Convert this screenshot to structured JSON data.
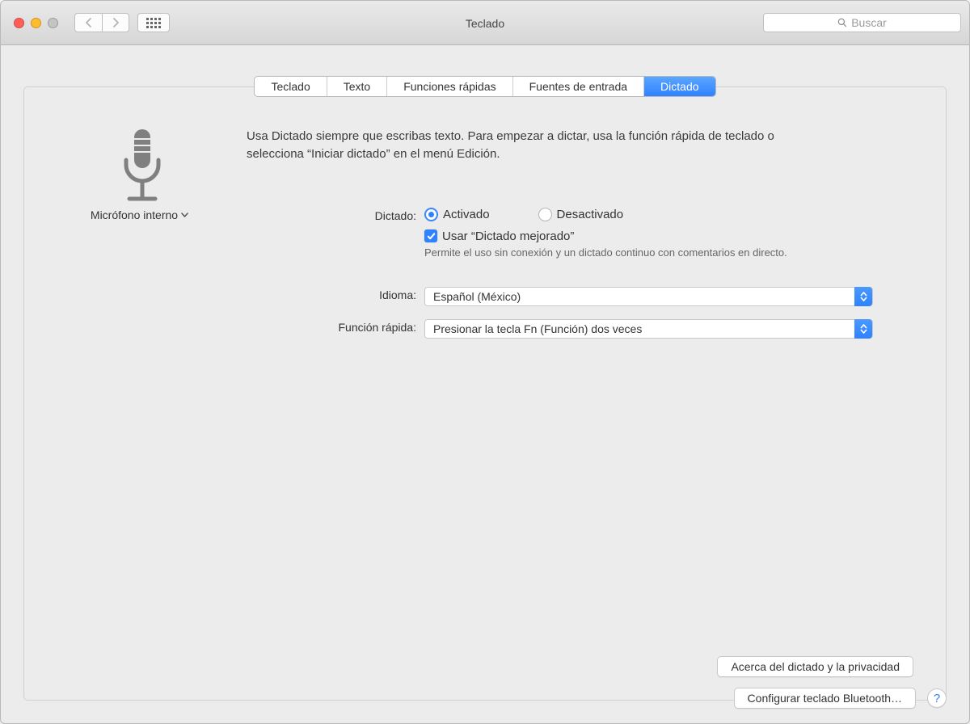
{
  "window": {
    "title": "Teclado"
  },
  "toolbar": {
    "search_placeholder": "Buscar"
  },
  "tabs": [
    "Teclado",
    "Texto",
    "Funciones rápidas",
    "Fuentes de entrada",
    "Dictado"
  ],
  "active_tab_index": 4,
  "mic": {
    "label": "Micrófono interno"
  },
  "description": "Usa Dictado siempre que escribas texto. Para empezar a dictar, usa la función rápida de teclado o selecciona “Iniciar dictado” en el menú Edición.",
  "labels": {
    "dictation": "Dictado:",
    "language": "Idioma:",
    "shortcut": "Función rápida:"
  },
  "dictation": {
    "on": "Activado",
    "off": "Desactivado",
    "selected": "on",
    "enhanced_label": "Usar “Dictado mejorado”",
    "enhanced_checked": true,
    "enhanced_desc": "Permite el uso sin conexión y un dictado continuo con comentarios en directo."
  },
  "language": {
    "value": "Español (México)"
  },
  "shortcut": {
    "value": "Presionar la tecla Fn (Función) dos veces"
  },
  "buttons": {
    "privacy": "Acerca del dictado y la privacidad",
    "bluetooth": "Configurar teclado Bluetooth…",
    "help": "?"
  }
}
